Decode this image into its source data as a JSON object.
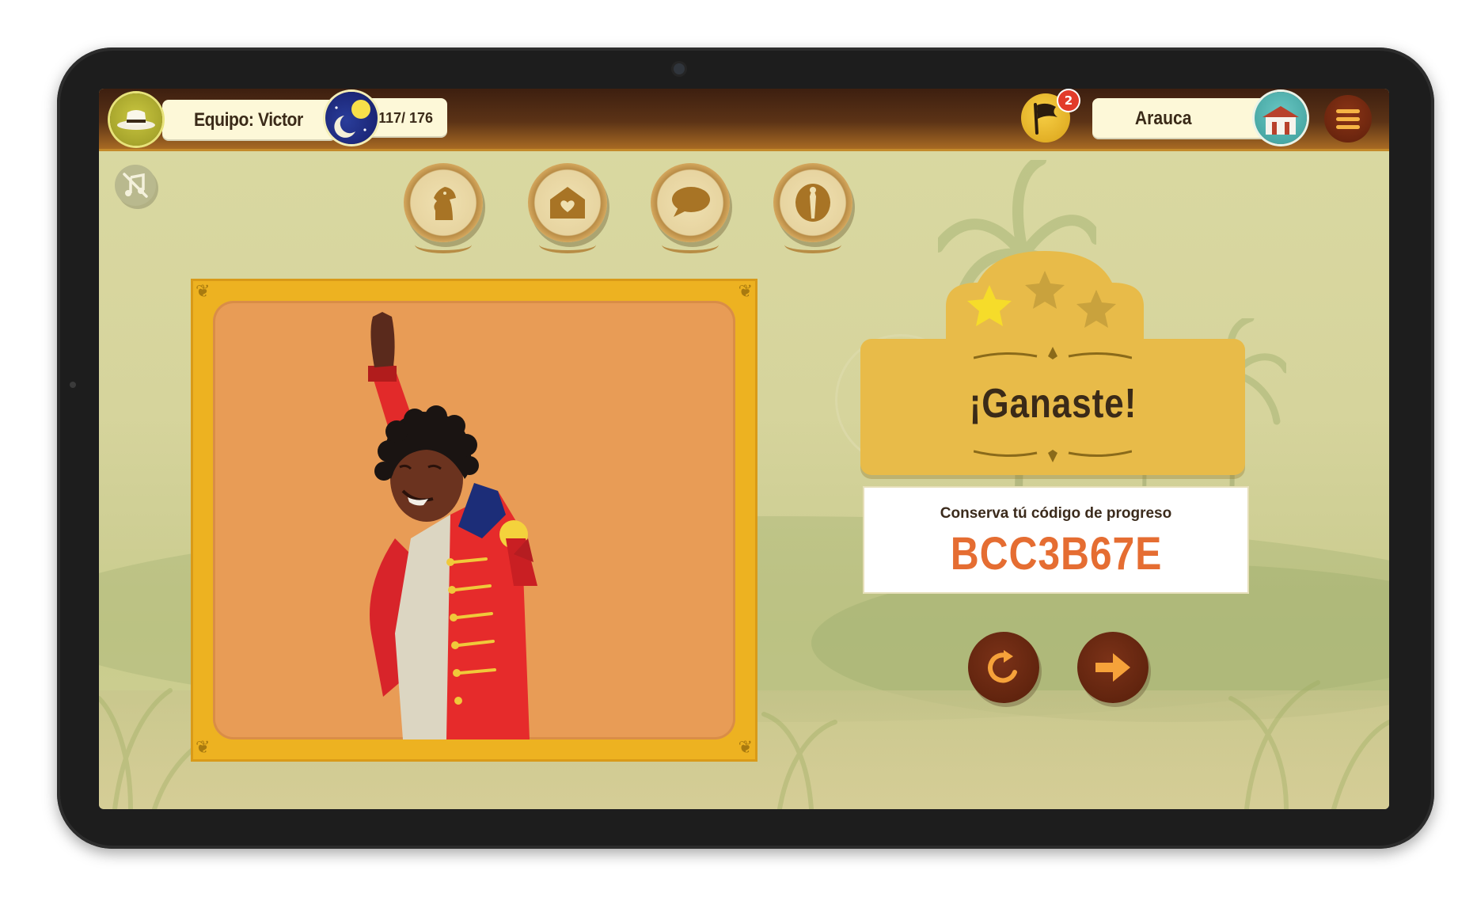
{
  "topbar": {
    "team_label": "Equipo: Victor",
    "progress_text": "117/ 176",
    "notification_count": "2",
    "location_label": "Arauca"
  },
  "result": {
    "title": "¡Ganaste!",
    "stars_earned": 1,
    "stars_total": 3,
    "code_label": "Conserva tú código de progreso",
    "code_value": "BCC3B67E"
  },
  "categories": [
    {
      "icon": "horse-icon"
    },
    {
      "icon": "house-heart-icon"
    },
    {
      "icon": "speech-bubble-icon"
    },
    {
      "icon": "character-icon"
    }
  ],
  "colors": {
    "topbar": "#5c3316",
    "frame": "#edb221",
    "banner": "#e8bb49",
    "code_text": "#e56d32",
    "button": "#6b2812",
    "arrow": "#f6a23a"
  }
}
